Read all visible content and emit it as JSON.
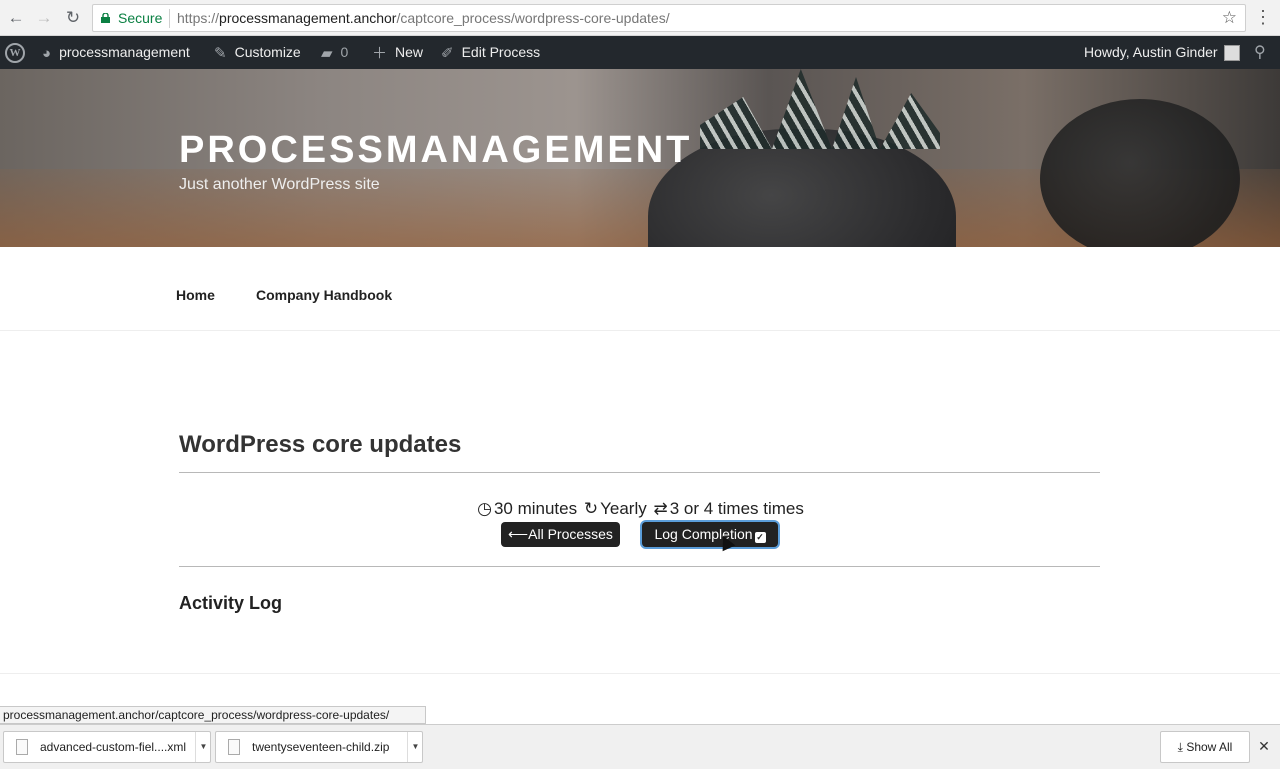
{
  "browser": {
    "secure_label": "Secure",
    "url_prefix": "https://",
    "url_host": "processmanagement.anchor",
    "url_path": "/captcore_process/wordpress-core-updates/",
    "back_icon": "←",
    "forward_icon": "→",
    "reload_icon": "↻",
    "star_icon": "☆",
    "menu_icon": "⋮"
  },
  "admin_bar": {
    "site_name": "processmanagement",
    "customize": "Customize",
    "comments_count": "0",
    "new_label": "New",
    "edit_label": "Edit Process",
    "howdy": "Howdy, Austin Ginder"
  },
  "header": {
    "site_title": "PROCESSMANAGEMENT",
    "tagline": "Just another WordPress site"
  },
  "nav": {
    "items": [
      {
        "label": "Home"
      },
      {
        "label": "Company Handbook"
      }
    ]
  },
  "process": {
    "title": "WordPress core updates",
    "duration": "30 minutes",
    "frequency": "Yearly",
    "repeat": "3 or 4 times times",
    "all_processes_label": "All Processes",
    "log_completion_label": "Log Completion",
    "activity_log_title": "Activity Log"
  },
  "status_bar": {
    "url": "processmanagement.anchor/captcore_process/wordpress-core-updates/"
  },
  "downloads": {
    "items": [
      {
        "name": "advanced-custom-fiel....xml"
      },
      {
        "name": "twentyseventeen-child.zip"
      }
    ],
    "show_all": "Show All",
    "close": "✕"
  }
}
